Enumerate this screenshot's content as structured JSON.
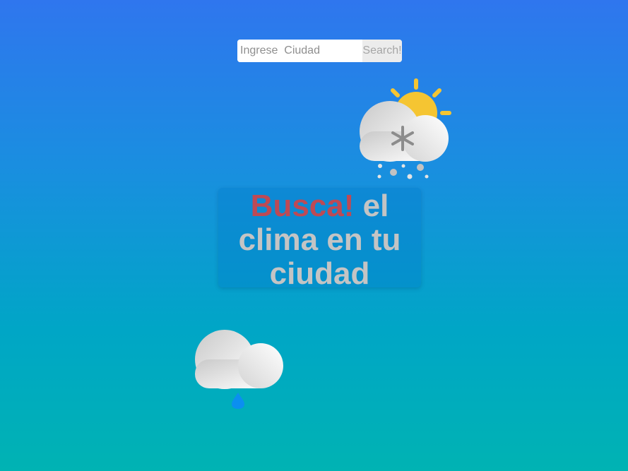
{
  "search": {
    "placeholder": "Ingrese  Ciudad",
    "value": "",
    "button_label": "Search!"
  },
  "headline": {
    "accent": "Busca!",
    "rest": " el clima en tu ciudad"
  },
  "icons": {
    "top": "sun-cloud-snow-icon",
    "bottom": "cloud-rain-drop-icon"
  },
  "colors": {
    "background_top": "#2f76ee",
    "background_bottom": "#00b3b3",
    "headline_accent": "#bd4a55",
    "headline_text": "#c4c4c4",
    "sun": "#f5c532",
    "rain_drop": "#0b8ff0"
  }
}
